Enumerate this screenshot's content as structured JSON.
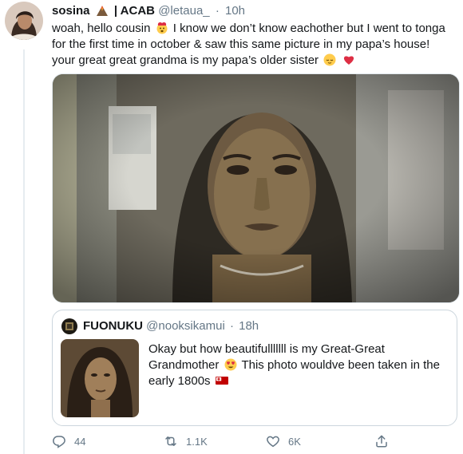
{
  "tweet": {
    "display_name": "sosina",
    "badge_text": "| ACAB",
    "handle": "@letaua_",
    "dot": "·",
    "time": "10h",
    "text": {
      "part1": "woah, hello cousin",
      "part2": "I know we don’t know eachother but I went to tonga for the first time in october & saw this same picture in my papa’s house! your great great grandma is my papa’s older sister"
    },
    "emojis": [
      "exploding-head-emoji",
      "relieved-face-emoji",
      "red-heart-emoji"
    ]
  },
  "quote": {
    "display_name": "FUONUKU",
    "handle": "@nooksikamui",
    "dot": "·",
    "time": "18h",
    "text": {
      "part1": "Okay but how beautifulllllll is my Great-Great Grandmother",
      "part2": "This photo wouldve been taken in the early 1800s"
    },
    "emojis": [
      "heart-eyes-emoji",
      "tonga-flag-emoji"
    ]
  },
  "actions": {
    "reply_count": "44",
    "retweet_count": "1.1K",
    "like_count": "6K"
  },
  "colors": {
    "text": "#14171a",
    "secondary": "#657786",
    "border": "#ccd6dd"
  }
}
